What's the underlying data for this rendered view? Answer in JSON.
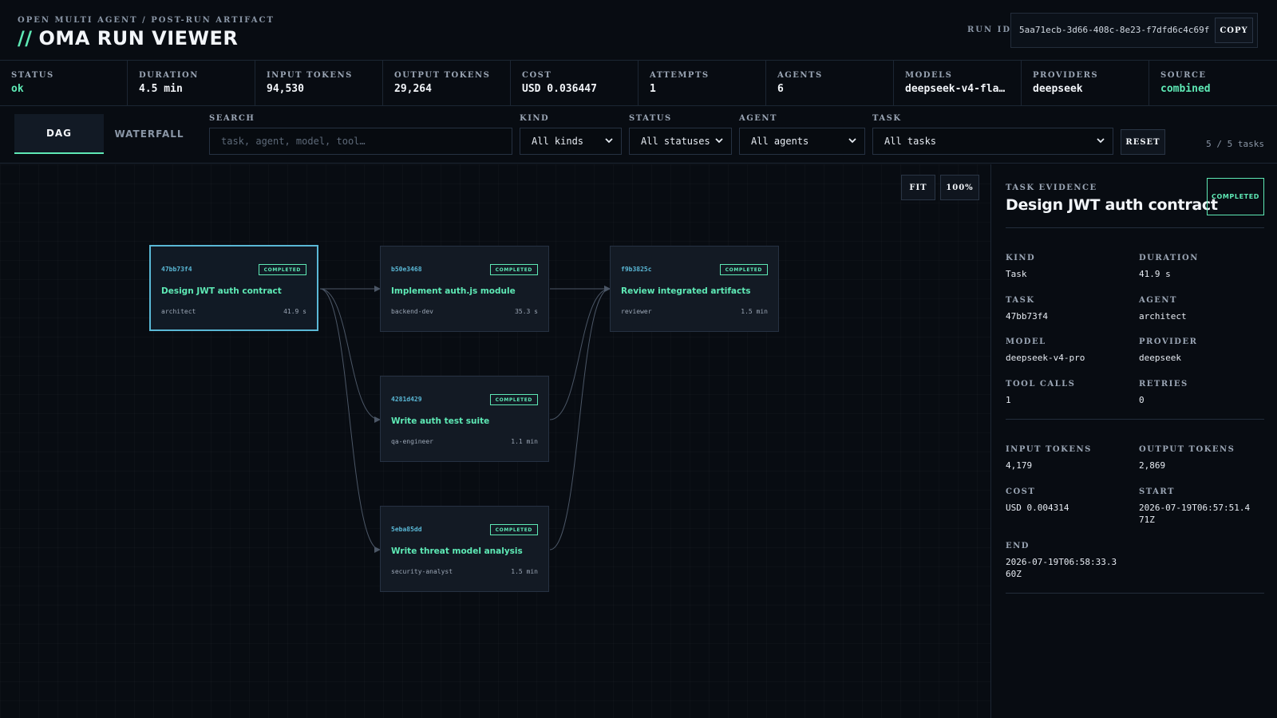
{
  "header": {
    "eyebrow": "OPEN MULTI AGENT / POST-RUN ARTIFACT",
    "title_prefix": "//",
    "title": "OMA RUN VIEWER",
    "run_id_label": "RUN ID",
    "run_id": "5aa71ecb-3d66-408c-8e23-f7dfd6c4c69f",
    "copy_label": "COPY"
  },
  "stats": [
    {
      "label": "STATUS",
      "value": "ok"
    },
    {
      "label": "DURATION",
      "value": "4.5 min"
    },
    {
      "label": "INPUT TOKENS",
      "value": "94,530"
    },
    {
      "label": "OUTPUT TOKENS",
      "value": "29,264"
    },
    {
      "label": "COST",
      "value": "USD 0.036447"
    },
    {
      "label": "ATTEMPTS",
      "value": "1"
    },
    {
      "label": "AGENTS",
      "value": "6"
    },
    {
      "label": "MODELS",
      "value": "deepseek-v4-fla…"
    },
    {
      "label": "PROVIDERS",
      "value": "deepseek"
    },
    {
      "label": "SOURCE",
      "value": "combined"
    }
  ],
  "tabs": {
    "dag": "DAG",
    "waterfall": "WATERFALL"
  },
  "filters": {
    "search_label": "SEARCH",
    "search_placeholder": "task, agent, model, tool…",
    "kind_label": "KIND",
    "kind_value": "All kinds",
    "status_label": "STATUS",
    "status_value": "All statuses",
    "agent_label": "AGENT",
    "agent_value": "All agents",
    "task_label": "TASK",
    "task_value": "All tasks",
    "reset_label": "RESET",
    "task_count": "5 / 5 tasks"
  },
  "canvas": {
    "fit_label": "FIT",
    "zoom_label": "100%"
  },
  "nodes": [
    {
      "id": "47bb73f4",
      "status": "COMPLETED",
      "title": "Design JWT auth contract",
      "agent": "architect",
      "duration": "41.9 s"
    },
    {
      "id": "b50e3468",
      "status": "COMPLETED",
      "title": "Implement auth.js module",
      "agent": "backend-dev",
      "duration": "35.3 s"
    },
    {
      "id": "f9b3825c",
      "status": "COMPLETED",
      "title": "Review integrated artifacts",
      "agent": "reviewer",
      "duration": "1.5 min"
    },
    {
      "id": "4281d429",
      "status": "COMPLETED",
      "title": "Write auth test suite",
      "agent": "qa-engineer",
      "duration": "1.1 min"
    },
    {
      "id": "5eba85dd",
      "status": "COMPLETED",
      "title": "Write threat model analysis",
      "agent": "security-analyst",
      "duration": "1.5 min"
    }
  ],
  "panel": {
    "eyebrow": "TASK EVIDENCE",
    "title": "Design JWT auth contract",
    "status": "COMPLETED",
    "fields": [
      {
        "label": "KIND",
        "value": "Task"
      },
      {
        "label": "DURATION",
        "value": "41.9 s"
      },
      {
        "label": "TASK",
        "value": "47bb73f4"
      },
      {
        "label": "AGENT",
        "value": "architect"
      },
      {
        "label": "MODEL",
        "value": "deepseek-v4-pro"
      },
      {
        "label": "PROVIDER",
        "value": "deepseek"
      },
      {
        "label": "TOOL CALLS",
        "value": "1"
      },
      {
        "label": "RETRIES",
        "value": "0"
      }
    ],
    "fields2": [
      {
        "label": "INPUT TOKENS",
        "value": "4,179"
      },
      {
        "label": "OUTPUT TOKENS",
        "value": "2,869"
      },
      {
        "label": "COST",
        "value": "USD 0.004314"
      },
      {
        "label": "START",
        "value": "2026-07-19T06:57:51.471Z"
      },
      {
        "label": "END",
        "value": "2026-07-19T06:58:33.360Z"
      }
    ]
  },
  "colors": {
    "accent": "#5ee9b5",
    "selected": "#5ab8d6",
    "background": "#080c12"
  }
}
